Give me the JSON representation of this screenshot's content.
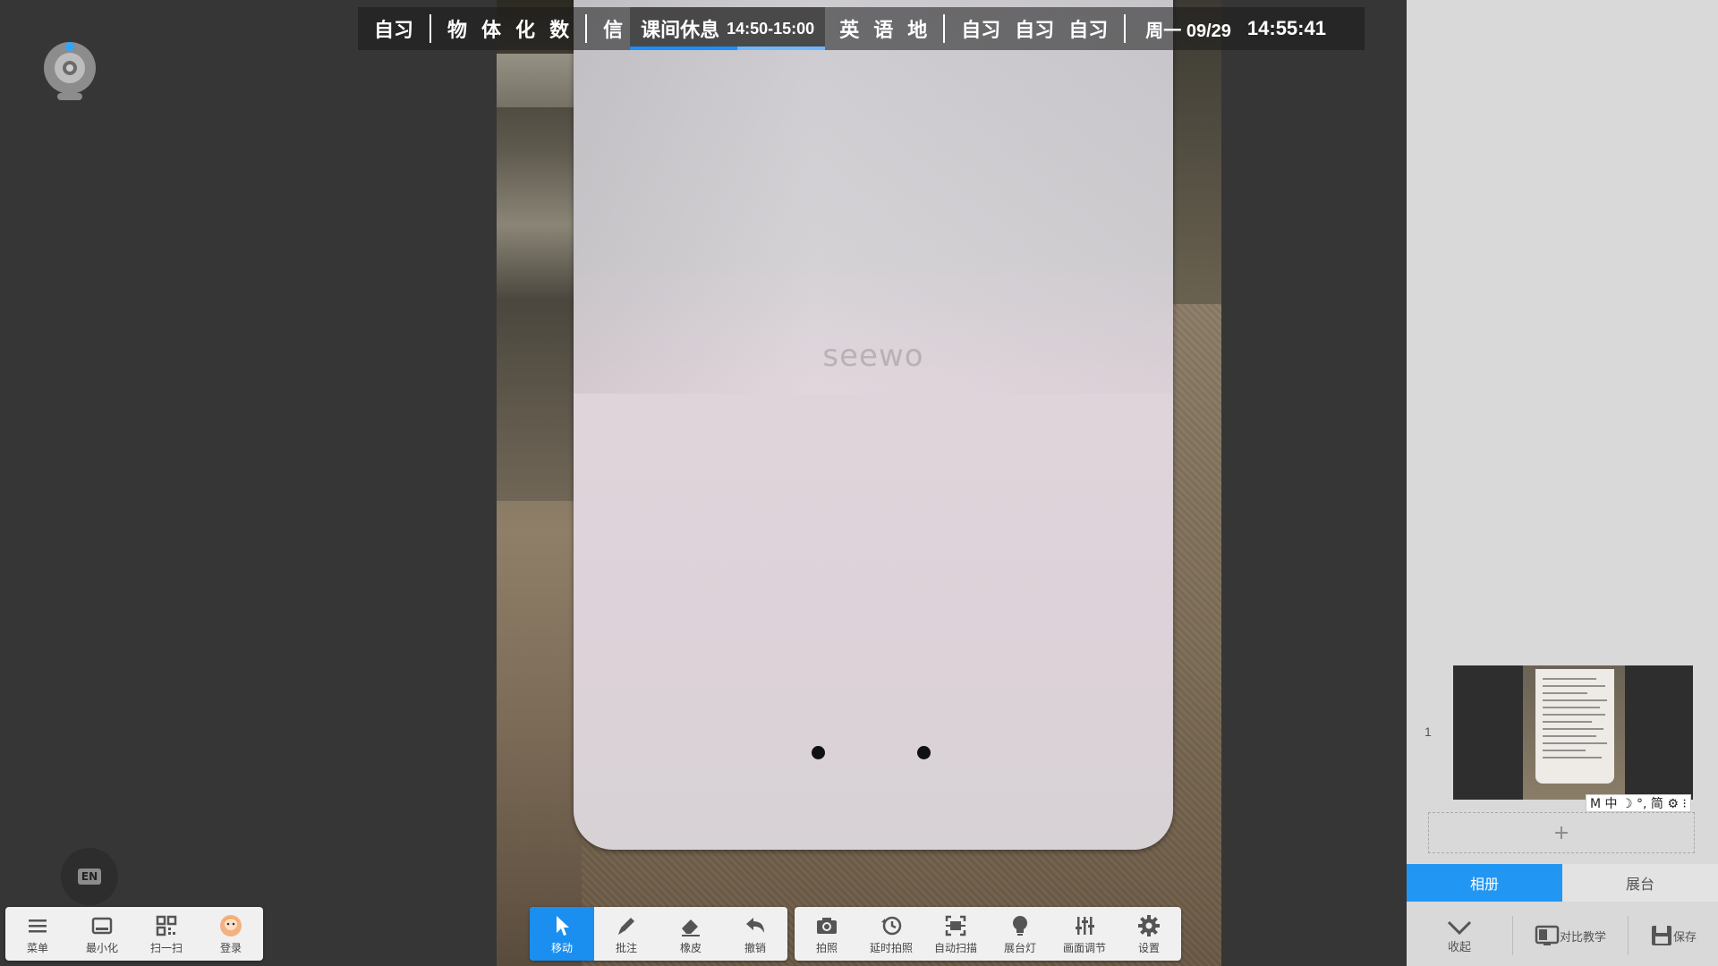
{
  "schedule": {
    "morning_self_study": "自习",
    "subjects_a": [
      "物",
      "体",
      "化",
      "数"
    ],
    "subject_info": "信",
    "break_label": "课间休息",
    "break_time": "14:50-15:00",
    "break_progress": 0.55,
    "subjects_b": [
      "英",
      "语",
      "地"
    ],
    "evening_self_study": [
      "自习",
      "自习",
      "自习"
    ],
    "date": "周一 09/29",
    "clock": "14:55:41"
  },
  "camera": {
    "brand_text": "seewo"
  },
  "left_toolbar": [
    {
      "label": "菜单",
      "icon": "menu-icon"
    },
    {
      "label": "最小化",
      "icon": "minimize-icon"
    },
    {
      "label": "扫一扫",
      "icon": "qrcode-icon"
    },
    {
      "label": "登录",
      "icon": "avatar-icon"
    }
  ],
  "en_button": {
    "label": "EN"
  },
  "edit_toolbar": [
    {
      "label": "移动",
      "icon": "cursor-icon",
      "active": true
    },
    {
      "label": "批注",
      "icon": "pen-icon"
    },
    {
      "label": "橡皮",
      "icon": "eraser-icon"
    },
    {
      "label": "撤销",
      "icon": "undo-icon"
    }
  ],
  "camera_toolbar": [
    {
      "label": "拍照",
      "icon": "camera-icon"
    },
    {
      "label": "延时拍照",
      "icon": "timer-icon"
    },
    {
      "label": "自动扫描",
      "icon": "scan-icon"
    },
    {
      "label": "展台灯",
      "icon": "bulb-icon"
    },
    {
      "label": "画面调节",
      "icon": "sliders-icon"
    },
    {
      "label": "设置",
      "icon": "gear-icon"
    }
  ],
  "sidebar": {
    "thumb_index": "1",
    "add_symbol": "+",
    "ime_bar": "M 中 ☽ °, 简 ⚙ ⁝",
    "tabs": [
      {
        "label": "相册",
        "active": true
      },
      {
        "label": "展台",
        "active": false
      }
    ],
    "tools": [
      {
        "label": "收起",
        "icon": "chevron-down-icon"
      },
      {
        "label": "对比教学",
        "icon": "compare-icon"
      },
      {
        "label": "保存",
        "icon": "save-icon"
      }
    ]
  },
  "colors": {
    "accent": "#1a8fef",
    "tab_active": "#2196f3",
    "background": "#363636",
    "sidebar": "#d9d9d9"
  }
}
